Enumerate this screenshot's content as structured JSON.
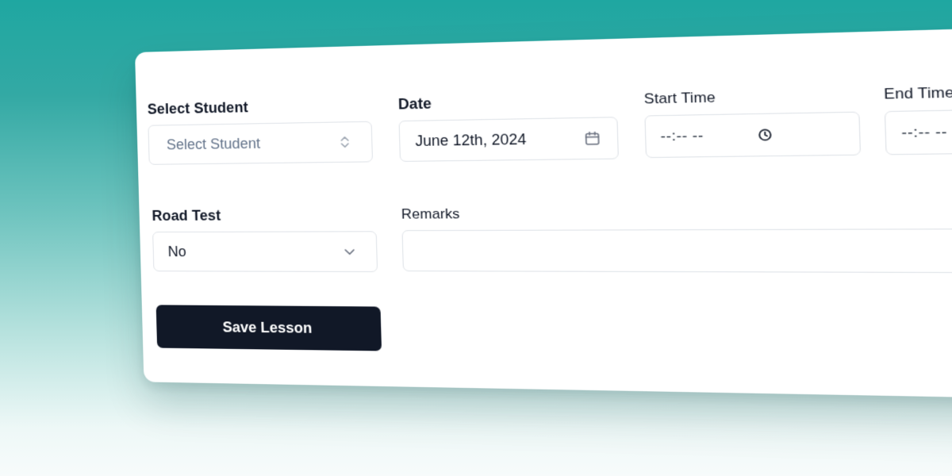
{
  "form": {
    "student": {
      "label": "Select Student",
      "placeholder": "Select Student",
      "icon": "chevron-up-down-icon"
    },
    "date": {
      "label": "Date",
      "value": "June 12th, 2024",
      "icon": "calendar-icon"
    },
    "start_time": {
      "label": "Start Time",
      "value": "--:-- --",
      "icon": "clock-icon"
    },
    "end_time": {
      "label": "End Time",
      "value": "--:-- --",
      "icon": "clock-icon"
    },
    "road_test": {
      "label": "Road Test",
      "value": "No",
      "icon": "chevron-down-icon"
    },
    "remarks": {
      "label": "Remarks",
      "value": ""
    },
    "save_button": {
      "label": "Save Lesson"
    }
  },
  "colors": {
    "background_top": "#1fa7a1",
    "background_bottom": "#f7fbfb",
    "button": "#111827",
    "border": "#dfe3e8",
    "placeholder": "#64748b"
  }
}
